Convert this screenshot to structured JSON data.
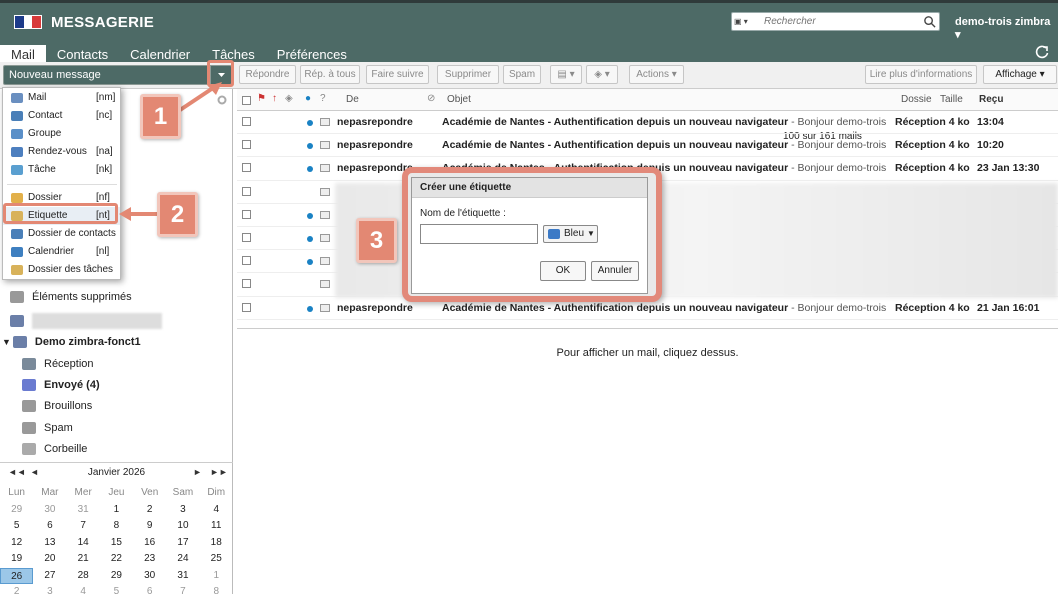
{
  "header": {
    "app_title": "MESSAGERIE",
    "search_placeholder": "Rechercher",
    "user": "demo-trois zimbra",
    "tabs": [
      "Mail",
      "Contacts",
      "Calendrier",
      "Tâches",
      "Préférences"
    ],
    "active_tab": "Mail"
  },
  "toolbar": {
    "new_message": "Nouveau message",
    "reply": "Répondre",
    "reply_all": "Rép. à tous",
    "forward": "Faire suivre",
    "delete": "Supprimer",
    "spam": "Spam",
    "actions": "Actions",
    "count": "100 sur 161 mails",
    "read_more": "Lire plus d'informations",
    "view": "Affichage"
  },
  "new_menu": [
    {
      "label": "Mail",
      "shortcut": "[nm]",
      "icon": "mail-icon"
    },
    {
      "label": "Contact",
      "shortcut": "[nc]",
      "icon": "contact-icon"
    },
    {
      "label": "Groupe",
      "shortcut": "",
      "icon": "group-icon"
    },
    {
      "label": "Rendez-vous",
      "shortcut": "[na]",
      "icon": "appointment-icon"
    },
    {
      "label": "Tâche",
      "shortcut": "[nk]",
      "icon": "task-icon"
    },
    {
      "label": "Dossier",
      "shortcut": "[nf]",
      "icon": "folder-icon"
    },
    {
      "label": "Etiquette",
      "shortcut": "[nt]",
      "icon": "tag-icon"
    },
    {
      "label": "Dossier de contacts",
      "shortcut": "",
      "icon": "contacts-folder-icon"
    },
    {
      "label": "Calendrier",
      "shortcut": "[nl]",
      "icon": "calendar-icon"
    },
    {
      "label": "Dossier des tâches",
      "shortcut": "",
      "icon": "tasks-folder-icon"
    }
  ],
  "sidebar": {
    "deleted": "Éléments supprimés",
    "account": "Demo zimbra-fonct1",
    "folders": [
      "Réception",
      "Envoyé (4)",
      "Brouillons",
      "Spam",
      "Corbeille"
    ]
  },
  "calendar": {
    "month": "Janvier 2026",
    "days": [
      "Lun",
      "Mar",
      "Mer",
      "Jeu",
      "Ven",
      "Sam",
      "Dim"
    ],
    "weeks": [
      [
        "29",
        "30",
        "31",
        "1",
        "2",
        "3",
        "4"
      ],
      [
        "5",
        "6",
        "7",
        "8",
        "9",
        "10",
        "11"
      ],
      [
        "12",
        "13",
        "14",
        "15",
        "16",
        "17",
        "18"
      ],
      [
        "19",
        "20",
        "21",
        "22",
        "23",
        "24",
        "25"
      ],
      [
        "26",
        "27",
        "28",
        "29",
        "30",
        "31",
        "1"
      ],
      [
        "2",
        "3",
        "4",
        "5",
        "6",
        "7",
        "8"
      ]
    ],
    "today": "26"
  },
  "list_headers": {
    "from": "De",
    "subject": "Objet",
    "folder": "Dossie",
    "size": "Taille",
    "received": "Reçu"
  },
  "messages": [
    {
      "from": "nepasrepondre",
      "subject": "Académie de Nantes - Authentification depuis un nouveau navigateur",
      "snippet": " - Bonjour demo-trois zimbra, Ur",
      "folder": "Réception",
      "size": "4 ko",
      "date": "13:04"
    },
    {
      "from": "nepasrepondre",
      "subject": "Académie de Nantes - Authentification depuis un nouveau navigateur",
      "snippet": " - Bonjour demo-trois zimbra, Ur",
      "folder": "Réception",
      "size": "4 ko",
      "date": "10:20"
    },
    {
      "from": "nepasrepondre",
      "subject": "Académie de Nantes - Authentification depuis un nouveau navigateur",
      "snippet": " - Bonjour demo-trois zimbra, Ur",
      "folder": "Réception",
      "size": "4 ko",
      "date": "23 Jan 13:30"
    },
    {
      "from": "",
      "subject": "",
      "snippet": "",
      "folder": "",
      "size": "",
      "date": ""
    },
    {
      "from": "",
      "subject": "",
      "snippet": "",
      "folder": "",
      "size": "",
      "date": ""
    },
    {
      "from": "",
      "subject": "",
      "snippet": "",
      "folder": "",
      "size": "",
      "date": ""
    },
    {
      "from": "",
      "subject": "",
      "snippet": "",
      "folder": "",
      "size": "",
      "date": ""
    },
    {
      "from": "",
      "subject": "",
      "snippet": "",
      "folder": "",
      "size": "",
      "date": ""
    },
    {
      "from": "nepasrepondre",
      "subject": "Académie de Nantes - Authentification depuis un nouveau navigateur",
      "snippet": " - Bonjour demo-trois zimbra, Ur",
      "folder": "Réception",
      "size": "4 ko",
      "date": "21 Jan 16:01"
    }
  ],
  "reading_pane": "Pour afficher un mail, cliquez dessus.",
  "dialog": {
    "title": "Créer une étiquette",
    "label": "Nom de l'étiquette :",
    "color": "Bleu",
    "ok": "OK",
    "cancel": "Annuler"
  },
  "callouts": [
    "1",
    "2",
    "3"
  ],
  "colors": {
    "header": "#4d6a66",
    "accent": "#e38873",
    "unread_dot": "#1a82c4"
  }
}
